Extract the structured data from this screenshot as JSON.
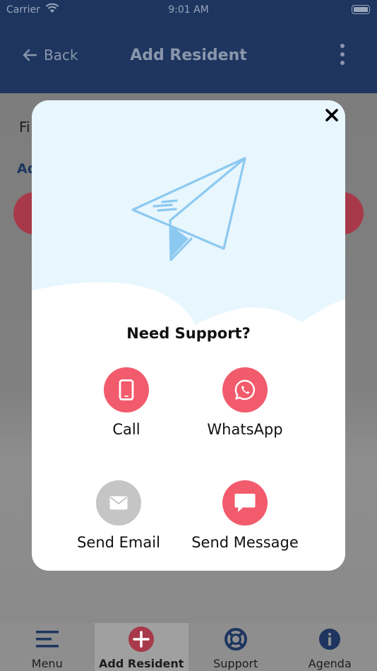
{
  "status_bar": {
    "carrier": "Carrier",
    "time": "9:01 AM"
  },
  "header": {
    "back_label": "Back",
    "title": "Add Resident"
  },
  "background": {
    "label_first": "Fi",
    "label_second": "Ad"
  },
  "modal": {
    "title": "Need Support?",
    "actions": [
      {
        "label": "Call",
        "icon": "phone-icon",
        "color": "#f25b6c"
      },
      {
        "label": "WhatsApp",
        "icon": "whatsapp-icon",
        "color": "#f25b6c"
      },
      {
        "label": "Send Email",
        "icon": "mail-icon",
        "color": "#c5c5c5"
      },
      {
        "label": "Send Message",
        "icon": "chat-icon",
        "color": "#f25b6c"
      }
    ]
  },
  "tabbar": {
    "items": [
      {
        "label": "Menu",
        "icon": "menu-icon"
      },
      {
        "label": "Add Resident",
        "icon": "add-circle-icon",
        "active": true
      },
      {
        "label": "Support",
        "icon": "lifebuoy-icon"
      },
      {
        "label": "Agenda",
        "icon": "info-icon"
      }
    ]
  },
  "colors": {
    "navy": "#1d355f",
    "accent_red": "#f25b6c",
    "hero_blue": "#e8f6fe",
    "plane_blue": "#8cc9f0"
  }
}
